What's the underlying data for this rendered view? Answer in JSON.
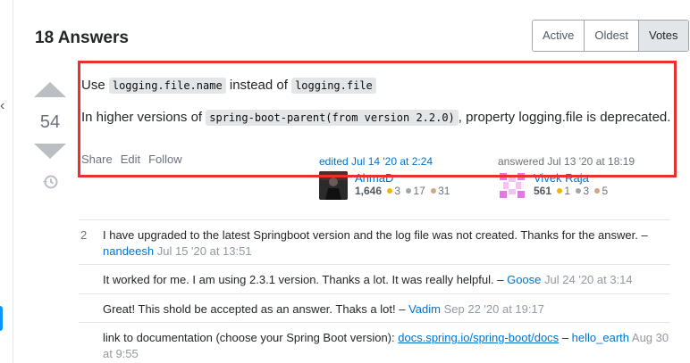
{
  "header": {
    "answers_count": "18 Answers"
  },
  "sort": {
    "options": [
      "Active",
      "Oldest",
      "Votes"
    ],
    "selected": "Votes"
  },
  "answer": {
    "score": "54",
    "body": {
      "p1_prefix": "Use",
      "p1_code1": "logging.file.name",
      "p1_middle": "instead of",
      "p1_code2": "logging.file",
      "p2_prefix": "In higher versions of",
      "p2_code": "spring-boot-parent(from version 2.2.0)",
      "p2_suffix": ", property logging.file is deprecated."
    },
    "menu": {
      "share": "Share",
      "edit": "Edit",
      "follow": "Follow"
    },
    "edited": {
      "label": "edited Jul 14 '20 at 2:24",
      "user": "AhmaD",
      "reputation": "1,646",
      "gold": "3",
      "silver": "17",
      "bronze": "31"
    },
    "answered": {
      "label": "answered Jul 13 '20 at 18:19",
      "user": "Vivek Raja",
      "reputation": "561",
      "gold": "1",
      "silver": "3",
      "bronze": "5"
    }
  },
  "comments": [
    {
      "score": "2",
      "text": "I have upgraded to the latest Springboot version and the log file was not created. Thanks for the answer. –",
      "user": "nandeesh",
      "date": "Jul 15 '20 at 13:51"
    },
    {
      "score": "",
      "text": "It worked for me. I am using 2.3.1 version. Thanks a lot. It was really helpful. –",
      "user": "Goose",
      "date": "Jul 24 '20 at 3:14"
    },
    {
      "score": "",
      "text": "Great! This shold be accepted as an answer. Thaks a lot! –",
      "user": "Vadim",
      "date": "Sep 22 '20 at 19:17"
    },
    {
      "score": "",
      "text": "link to documentation (choose your Spring Boot version):",
      "link": "docs.spring.io/spring-boot/docs",
      "sep": "–",
      "user": "hello_earth",
      "date": "Aug 30 at 9:55"
    }
  ],
  "colors": {
    "highlight": "#e8302f",
    "link": "#0074cc",
    "gold": "#f1b600",
    "silver": "#9fa6ad",
    "bronze": "#d1a684"
  },
  "icons": {
    "rail": "chevron-left-icon",
    "history": "history-icon"
  }
}
